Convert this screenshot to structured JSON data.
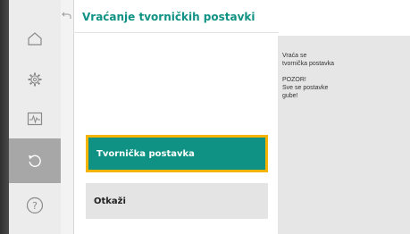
{
  "header": {
    "title": "Vraćanje tvorničkih postavki"
  },
  "sidebar": {
    "items": [
      {
        "icon": "home-icon",
        "active": false
      },
      {
        "icon": "gear-icon",
        "active": false
      },
      {
        "icon": "diagnostics-icon",
        "active": false
      },
      {
        "icon": "restore-icon",
        "active": true
      },
      {
        "icon": "help-icon",
        "active": false
      }
    ]
  },
  "info_panel": {
    "description_line1": "Vraća se",
    "description_line2": "tvornička postavka",
    "warning_line1": "POZOR!",
    "warning_line2": "Sve se postavke",
    "warning_line3": "gube!"
  },
  "actions": {
    "primary_label": "Tvornička postavka",
    "secondary_label": "Otkaži"
  },
  "colors": {
    "accent": "#0f9283",
    "focus": "#f5b400",
    "sidebar_bg": "#ececec",
    "sidebar_active": "#a7a7a7"
  }
}
